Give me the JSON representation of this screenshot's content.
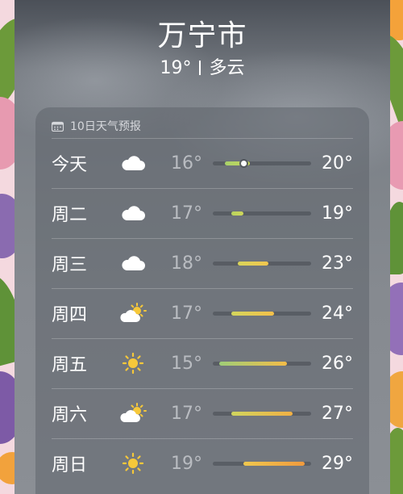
{
  "header": {
    "city": "万宁市",
    "current_temp": "19°",
    "condition": "多云"
  },
  "forecast": {
    "title": "10日天气预报",
    "icon": "calendar-icon",
    "range": {
      "min": 14,
      "max": 30
    },
    "current_temp_value": 19,
    "days": [
      {
        "day": "今天",
        "icon": "cloud-icon",
        "low": "16°",
        "high": "20°",
        "low_value": 16,
        "high_value": 20,
        "current": true,
        "colors": [
          "#a8d26a",
          "#c8d65a"
        ]
      },
      {
        "day": "周二",
        "icon": "cloud-icon",
        "low": "17°",
        "high": "19°",
        "low_value": 17,
        "high_value": 19,
        "current": false,
        "colors": [
          "#b8d45e",
          "#cfd65a"
        ]
      },
      {
        "day": "周三",
        "icon": "cloud-icon",
        "low": "18°",
        "high": "23°",
        "low_value": 18,
        "high_value": 23,
        "current": false,
        "colors": [
          "#d8d45a",
          "#f2c64e"
        ]
      },
      {
        "day": "周四",
        "icon": "sun-behind-cloud-icon",
        "low": "17°",
        "high": "24°",
        "low_value": 17,
        "high_value": 24,
        "current": false,
        "colors": [
          "#d4d65c",
          "#f4c04a"
        ]
      },
      {
        "day": "周五",
        "icon": "sun-icon",
        "low": "15°",
        "high": "26°",
        "low_value": 15,
        "high_value": 26,
        "current": false,
        "colors": [
          "#9fce78",
          "#f3bc48"
        ]
      },
      {
        "day": "周六",
        "icon": "sun-behind-cloud-icon",
        "low": "17°",
        "high": "27°",
        "low_value": 17,
        "high_value": 27,
        "current": false,
        "colors": [
          "#d0d55e",
          "#f2b044"
        ]
      },
      {
        "day": "周日",
        "icon": "sun-icon",
        "low": "19°",
        "high": "29°",
        "low_value": 19,
        "high_value": 29,
        "current": false,
        "colors": [
          "#f0c84e",
          "#f09a3e"
        ]
      }
    ]
  }
}
